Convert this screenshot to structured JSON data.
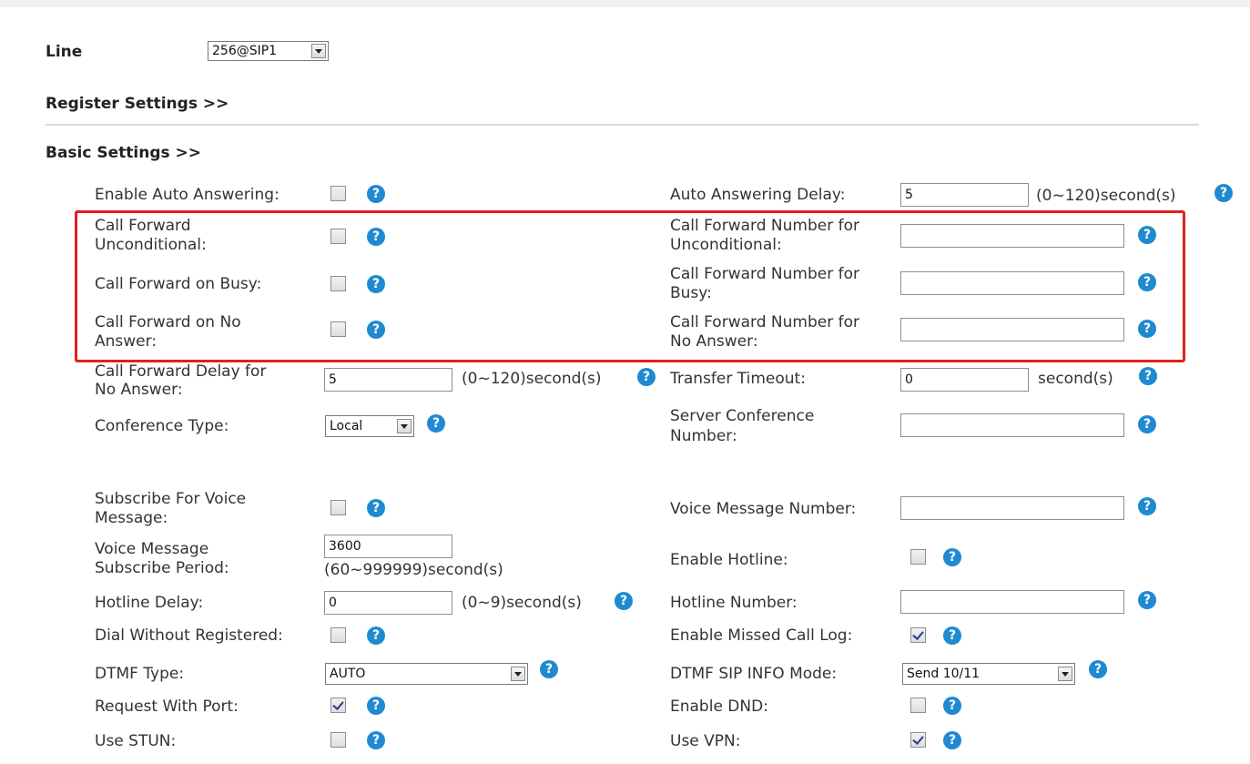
{
  "line": {
    "label": "Line",
    "value": "256@SIP1"
  },
  "sections": {
    "register": "Register Settings >>",
    "basic": "Basic Settings >>"
  },
  "icons": {
    "help": "?"
  },
  "fields": {
    "enable_auto_answering": {
      "label": "Enable Auto Answering:",
      "checked": false
    },
    "auto_answering_delay": {
      "label": "Auto Answering Delay:",
      "value": "5",
      "unit": "(0~120)second(s)"
    },
    "cf_unconditional": {
      "label_1": "Call Forward",
      "label_2": "Unconditional:",
      "checked": false
    },
    "cf_number_unconditional": {
      "label_1": "Call Forward Number for",
      "label_2": "Unconditional:",
      "value": ""
    },
    "cf_busy": {
      "label": "Call Forward on Busy:",
      "checked": false
    },
    "cf_number_busy": {
      "label_1": "Call Forward Number for",
      "label_2": "Busy:",
      "value": ""
    },
    "cf_no_answer": {
      "label_1": "Call Forward on No",
      "label_2": "Answer:",
      "checked": false
    },
    "cf_number_no_answer": {
      "label_1": "Call Forward Number for",
      "label_2": "No Answer:",
      "value": ""
    },
    "cf_delay_no_answer": {
      "label_1": "Call Forward Delay for",
      "label_2": "No Answer:",
      "value": "5",
      "unit": "(0~120)second(s)"
    },
    "transfer_timeout": {
      "label": "Transfer Timeout:",
      "value": "0",
      "unit": "second(s)"
    },
    "conference_type": {
      "label": "Conference Type:",
      "value": "Local"
    },
    "server_conference_number": {
      "label_1": "Server Conference",
      "label_2": "Number:",
      "value": ""
    },
    "subscribe_voice_message": {
      "label_1": "Subscribe For Voice",
      "label_2": "Message:",
      "checked": false
    },
    "voice_message_number": {
      "label": "Voice Message Number:",
      "value": ""
    },
    "voice_message_subscribe_period": {
      "label_1": "Voice Message",
      "label_2": "Subscribe Period:",
      "value": "3600",
      "unit": "(60~999999)second(s)"
    },
    "enable_hotline": {
      "label": "Enable Hotline:",
      "checked": false
    },
    "hotline_delay": {
      "label": "Hotline Delay:",
      "value": "0",
      "unit": "(0~9)second(s)"
    },
    "hotline_number": {
      "label": "Hotline Number:",
      "value": ""
    },
    "dial_without_registered": {
      "label": "Dial Without Registered:",
      "checked": false
    },
    "enable_missed_call_log": {
      "label": "Enable Missed Call Log:",
      "checked": true
    },
    "dtmf_type": {
      "label": "DTMF Type:",
      "value": "AUTO"
    },
    "dtmf_sip_info_mode": {
      "label": "DTMF SIP INFO Mode:",
      "value": "Send 10/11"
    },
    "request_with_port": {
      "label": "Request With Port:",
      "checked": true
    },
    "enable_dnd": {
      "label": "Enable DND:",
      "checked": false
    },
    "use_stun": {
      "label": "Use STUN:",
      "checked": false
    },
    "use_vpn": {
      "label": "Use VPN:",
      "checked": true
    }
  },
  "colors": {
    "help_icon": "#1f8ad0",
    "highlight_box": "#e02020",
    "separator": "#d9dcdf",
    "checkmark": "#2c3a8c"
  }
}
